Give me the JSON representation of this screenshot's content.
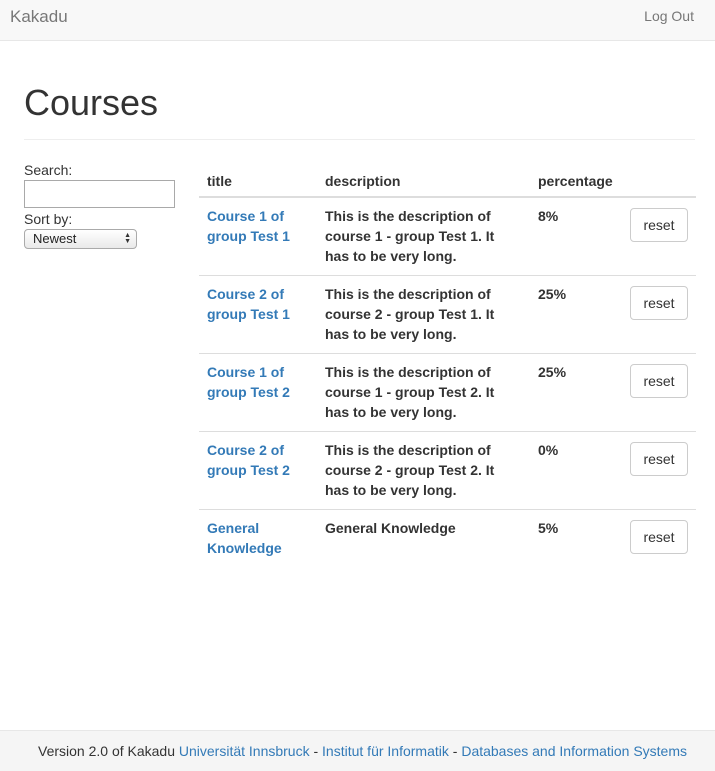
{
  "navbar": {
    "brand": "Kakadu",
    "logout_label": "Log Out"
  },
  "page": {
    "title": "Courses"
  },
  "sidebar": {
    "search_label": "Search:",
    "search_value": "",
    "sort_label": "Sort by:",
    "sort_selected": "Newest"
  },
  "table": {
    "headers": [
      "title",
      "description",
      "percentage",
      ""
    ],
    "reset_label": "reset",
    "rows": [
      {
        "title": "Course 1 of group Test 1",
        "description": "This is the description of course 1 - group Test 1. It has to be very long.",
        "percentage": "8%"
      },
      {
        "title": "Course 2 of group Test 1",
        "description": "This is the description of course 2 - group Test 1. It has to be very long.",
        "percentage": "25%"
      },
      {
        "title": "Course 1 of group Test 2",
        "description": "This is the description of course 1 - group Test 2. It has to be very long.",
        "percentage": "25%"
      },
      {
        "title": "Course 2 of group Test 2",
        "description": "This is the description of course 2 - group Test 2. It has to be very long.",
        "percentage": "0%"
      },
      {
        "title": "General Knowledge",
        "description": "General Knowledge",
        "percentage": "5%"
      }
    ]
  },
  "footer": {
    "prefix": "Version 2.0 of Kakadu ",
    "link_university": "Universität Innsbruck",
    "sep1": " - ",
    "link_institute": "Institut für Informatik",
    "sep2": " - ",
    "link_group": "Databases and Information Systems"
  },
  "colors": {
    "link": "#337ab7",
    "navbar_bg": "#f8f8f8",
    "footer_bg": "#f5f5f5"
  }
}
